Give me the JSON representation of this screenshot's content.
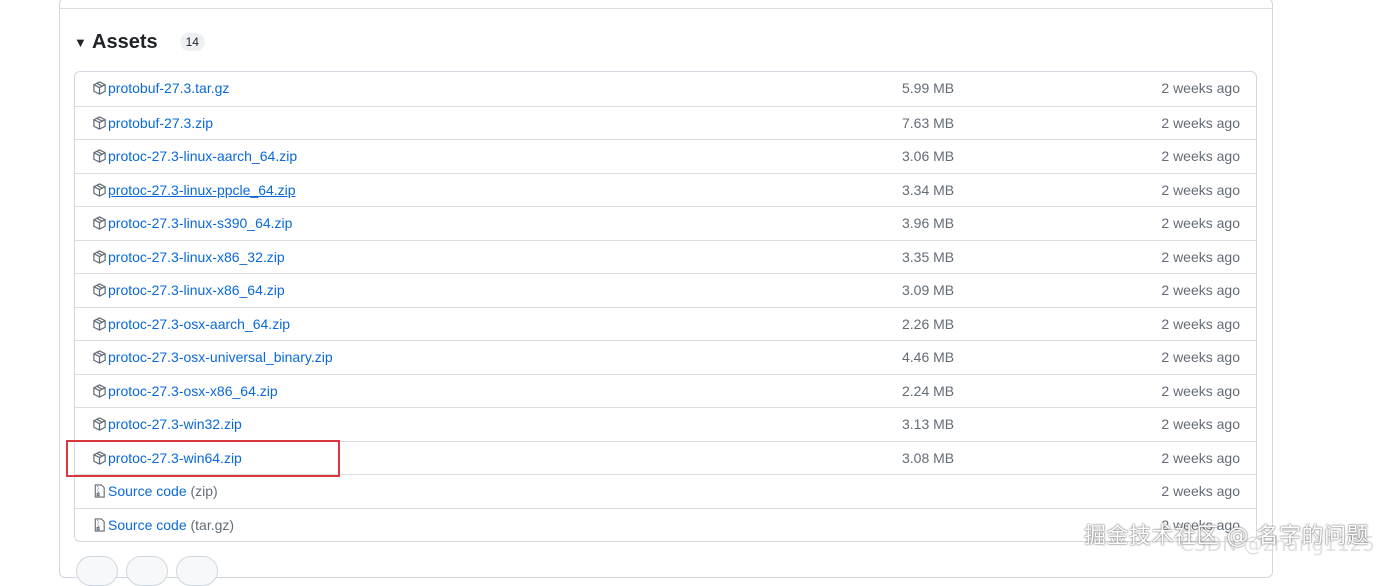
{
  "assets": {
    "title": "Assets",
    "count": "14",
    "items": [
      {
        "name": "protobuf-27.3.tar.gz",
        "size": "5.99 MB",
        "time": "2 weeks ago",
        "icon": "package-icon"
      },
      {
        "name": "protobuf-27.3.zip",
        "size": "7.63 MB",
        "time": "2 weeks ago",
        "icon": "package-icon"
      },
      {
        "name": "protoc-27.3-linux-aarch_64.zip",
        "size": "3.06 MB",
        "time": "2 weeks ago",
        "icon": "package-icon"
      },
      {
        "name": "protoc-27.3-linux-ppcle_64.zip",
        "size": "3.34 MB",
        "time": "2 weeks ago",
        "icon": "package-icon"
      },
      {
        "name": "protoc-27.3-linux-s390_64.zip",
        "size": "3.96 MB",
        "time": "2 weeks ago",
        "icon": "package-icon"
      },
      {
        "name": "protoc-27.3-linux-x86_32.zip",
        "size": "3.35 MB",
        "time": "2 weeks ago",
        "icon": "package-icon"
      },
      {
        "name": "protoc-27.3-linux-x86_64.zip",
        "size": "3.09 MB",
        "time": "2 weeks ago",
        "icon": "package-icon"
      },
      {
        "name": "protoc-27.3-osx-aarch_64.zip",
        "size": "2.26 MB",
        "time": "2 weeks ago",
        "icon": "package-icon"
      },
      {
        "name": "protoc-27.3-osx-universal_binary.zip",
        "size": "4.46 MB",
        "time": "2 weeks ago",
        "icon": "package-icon"
      },
      {
        "name": "protoc-27.3-osx-x86_64.zip",
        "size": "2.24 MB",
        "time": "2 weeks ago",
        "icon": "package-icon"
      },
      {
        "name": "protoc-27.3-win32.zip",
        "size": "3.13 MB",
        "time": "2 weeks ago",
        "icon": "package-icon"
      },
      {
        "name": "protoc-27.3-win64.zip",
        "size": "3.08 MB",
        "time": "2 weeks ago",
        "icon": "package-icon"
      },
      {
        "name": "Source code",
        "suffix": "(zip)",
        "size": "",
        "time": "2 weeks ago",
        "icon": "file-zip-icon"
      },
      {
        "name": "Source code",
        "suffix": "(tar.gz)",
        "size": "",
        "time": "2 weeks ago",
        "icon": "file-zip-icon"
      }
    ]
  },
  "watermark": {
    "text": "掘金技术社区 @ 名字的问题",
    "sub": "CSDN @zhang1125"
  },
  "colors": {
    "link": "#0969da",
    "muted": "#636c76",
    "border": "#d0d7de",
    "highlight": "#d9363e"
  }
}
